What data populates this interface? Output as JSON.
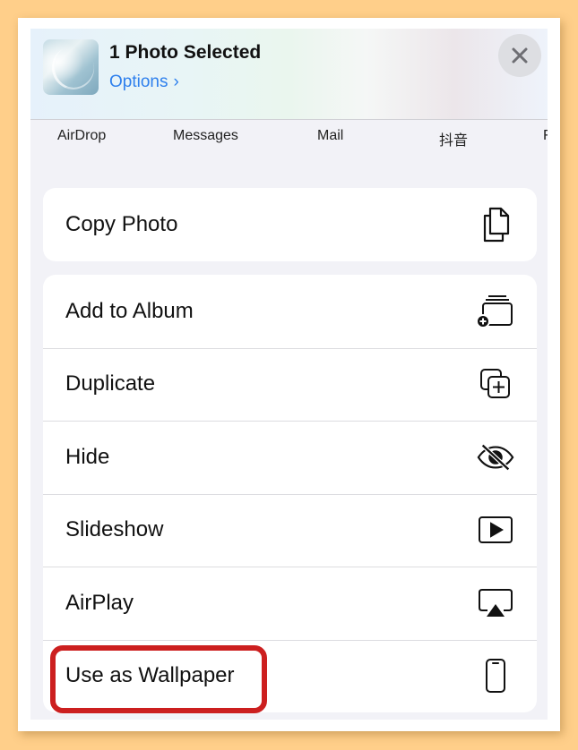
{
  "header": {
    "title": "1 Photo Selected",
    "options_label": "Options",
    "options_chevron": "›"
  },
  "icons": {
    "close": "close-icon",
    "copy": "copy-icon",
    "add_album": "add-to-album-icon",
    "duplicate": "duplicate-icon",
    "hide": "hide-eye-slash-icon",
    "slideshow": "play-icon",
    "airplay": "airplay-icon",
    "wallpaper": "phone-icon"
  },
  "apps": [
    "AirDrop",
    "Messages",
    "Mail",
    "抖音",
    "F"
  ],
  "actions_group1": [
    {
      "label": "Copy Photo"
    }
  ],
  "actions_group2": [
    {
      "label": "Add to Album"
    },
    {
      "label": "Duplicate"
    },
    {
      "label": "Hide"
    },
    {
      "label": "Slideshow"
    },
    {
      "label": "AirPlay"
    },
    {
      "label": "Use as Wallpaper"
    }
  ],
  "colors": {
    "accent": "#2F80ED",
    "highlight": "#CC1F1F",
    "background": "#FFCF8A"
  }
}
